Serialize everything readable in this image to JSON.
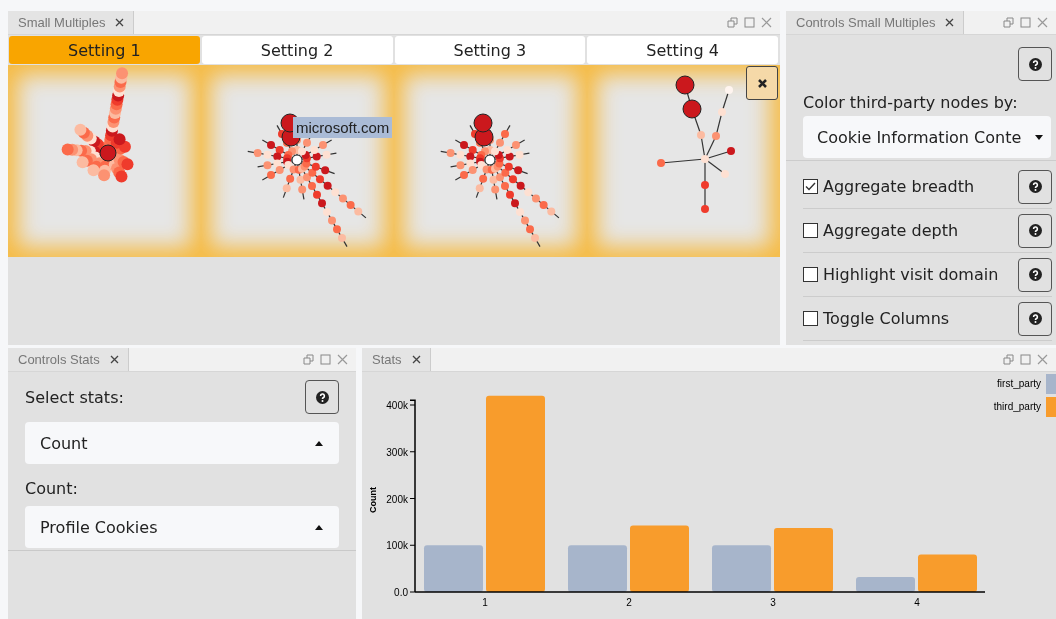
{
  "small_multiples": {
    "tab": "Small Multiples",
    "settings": [
      {
        "label": "Setting 1",
        "selected": true
      },
      {
        "label": "Setting 2",
        "selected": false
      },
      {
        "label": "Setting 3",
        "selected": false
      },
      {
        "label": "Setting 4",
        "selected": false
      }
    ],
    "tooltip": "microsoft.com"
  },
  "controls_small_multiples": {
    "tab": "Controls Small Multiples",
    "color_label": "Color third-party nodes by:",
    "color_value": "Cookie Information Conte",
    "options": [
      {
        "label": "Aggregate breadth",
        "checked": true
      },
      {
        "label": "Aggregate depth",
        "checked": false
      },
      {
        "label": "Highlight visit domain",
        "checked": false
      },
      {
        "label": "Toggle Columns",
        "checked": false
      }
    ]
  },
  "controls_stats": {
    "tab": "Controls Stats",
    "select_label": "Select stats:",
    "select_value": "Count",
    "count_label": "Count:",
    "count_value": "Profile Cookies"
  },
  "stats": {
    "tab": "Stats",
    "chart_data": {
      "type": "bar",
      "ylabel": "Count",
      "categories": [
        "1",
        "2",
        "3",
        "4"
      ],
      "series": [
        {
          "name": "first_party",
          "color": "#a7b5cb",
          "values": [
            100000,
            100000,
            100000,
            32000
          ]
        },
        {
          "name": "third_party",
          "color": "#f89c2c",
          "values": [
            420000,
            142000,
            137000,
            80000
          ]
        }
      ],
      "ylim": [
        0,
        420000
      ],
      "legend": "top-right",
      "yticks": [
        {
          "value": 0,
          "label": "0.0"
        },
        {
          "value": 100000,
          "label": "100k"
        },
        {
          "value": 200000,
          "label": "200k"
        },
        {
          "value": 300000,
          "label": "300k"
        },
        {
          "value": 400000,
          "label": "400k"
        }
      ]
    }
  }
}
